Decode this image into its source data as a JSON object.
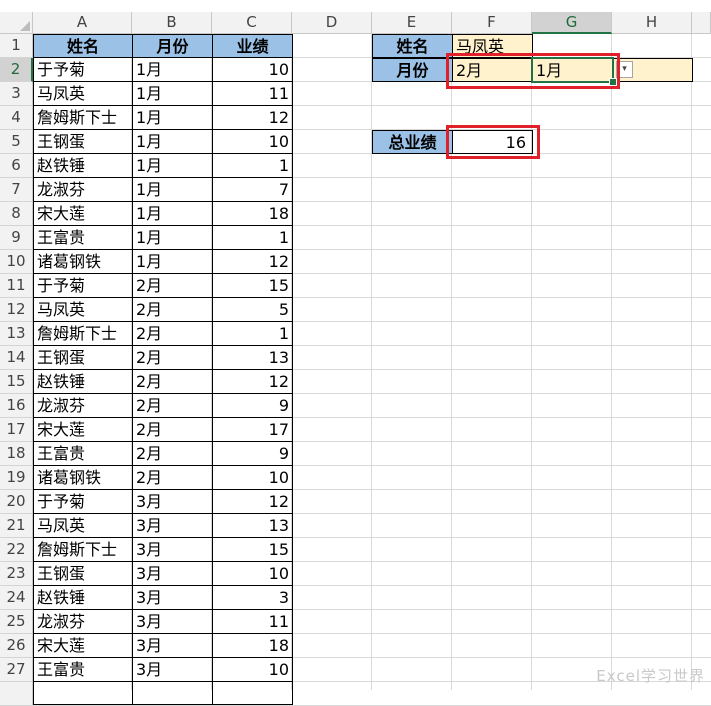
{
  "columns": [
    "A",
    "B",
    "C",
    "D",
    "E",
    "F",
    "G",
    "H"
  ],
  "row_numbers": [
    "1",
    "2",
    "3",
    "4",
    "5",
    "6",
    "7",
    "8",
    "9",
    "10",
    "11",
    "12",
    "13",
    "14",
    "15",
    "16",
    "17",
    "18",
    "19",
    "20",
    "21",
    "22",
    "23",
    "24",
    "25",
    "26",
    "27"
  ],
  "table": {
    "headers": [
      "姓名",
      "月份",
      "业绩"
    ],
    "rows": [
      [
        "于予菊",
        "1月",
        "10"
      ],
      [
        "马凤英",
        "1月",
        "11"
      ],
      [
        "詹姆斯下士",
        "1月",
        "12"
      ],
      [
        "王钢蛋",
        "1月",
        "10"
      ],
      [
        "赵铁锤",
        "1月",
        "1"
      ],
      [
        "龙淑芬",
        "1月",
        "7"
      ],
      [
        "宋大莲",
        "1月",
        "18"
      ],
      [
        "王富贵",
        "1月",
        "1"
      ],
      [
        "诸葛钢铁",
        "1月",
        "12"
      ],
      [
        "于予菊",
        "2月",
        "15"
      ],
      [
        "马凤英",
        "2月",
        "5"
      ],
      [
        "詹姆斯下士",
        "2月",
        "1"
      ],
      [
        "王钢蛋",
        "2月",
        "13"
      ],
      [
        "赵铁锤",
        "2月",
        "12"
      ],
      [
        "龙淑芬",
        "2月",
        "9"
      ],
      [
        "宋大莲",
        "2月",
        "17"
      ],
      [
        "王富贵",
        "2月",
        "9"
      ],
      [
        "诸葛钢铁",
        "2月",
        "10"
      ],
      [
        "于予菊",
        "3月",
        "12"
      ],
      [
        "马凤英",
        "3月",
        "13"
      ],
      [
        "詹姆斯下士",
        "3月",
        "15"
      ],
      [
        "王钢蛋",
        "3月",
        "10"
      ],
      [
        "赵铁锤",
        "3月",
        "3"
      ],
      [
        "龙淑芬",
        "3月",
        "11"
      ],
      [
        "宋大莲",
        "3月",
        "18"
      ],
      [
        "王富贵",
        "3月",
        "10"
      ]
    ]
  },
  "lookup": {
    "name_label": "姓名",
    "name_value": "马凤英",
    "month_label": "月份",
    "month_value_1": "2月",
    "month_value_2": "1月",
    "total_label": "总业绩",
    "total_value": "16"
  },
  "dropdown_arrow": "▾",
  "watermark": "Excel学习世界",
  "colors": {
    "header_fill": "#9bc2e6",
    "input_fill": "#fff2cc",
    "highlight_border": "#e0202a",
    "selection": "#217346"
  }
}
